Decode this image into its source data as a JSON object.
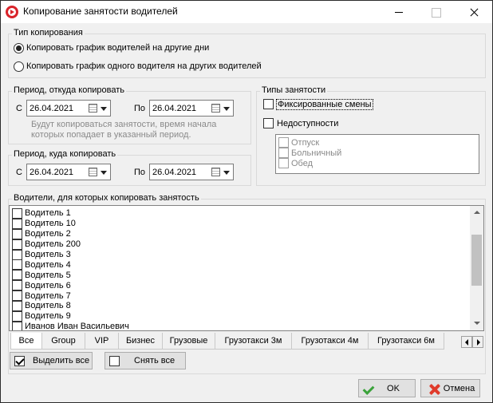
{
  "window": {
    "title": "Копирование занятости водителей",
    "accent_color": "#d9232a"
  },
  "copy_type": {
    "title": "Тип копирования",
    "options": [
      {
        "label": "Копировать график водителей на другие дни",
        "selected": true
      },
      {
        "label": "Копировать график одного водителя на других водителей",
        "selected": false
      }
    ]
  },
  "period_from": {
    "title": "Период, откуда копировать",
    "from_label": "С",
    "from_value": "26.04.2021",
    "to_label": "По",
    "to_value": "26.04.2021",
    "hint_line1": "Будут копироваться занятости, время начала",
    "hint_line2": "которых попадает в указанный период."
  },
  "period_to": {
    "title": "Период, куда копировать",
    "from_label": "С",
    "from_value": "26.04.2021",
    "to_label": "По",
    "to_value": "26.04.2021"
  },
  "occupancy_types": {
    "title": "Типы занятости",
    "fixed_shifts": {
      "label": "Фиксированные смены",
      "checked": false
    },
    "unavailability": {
      "label": "Недоступности",
      "checked": false
    },
    "sub_items": [
      {
        "label": "Отпуск",
        "checked": false
      },
      {
        "label": "Больничный",
        "checked": false
      },
      {
        "label": "Обед",
        "checked": false
      }
    ]
  },
  "drivers": {
    "title": "Водители, для которых копировать занятость",
    "items": [
      {
        "label": "Водитель 1",
        "checked": false
      },
      {
        "label": "Водитель 10",
        "checked": false
      },
      {
        "label": "Водитель 2",
        "checked": false
      },
      {
        "label": "Водитель 200",
        "checked": false
      },
      {
        "label": "Водитель 3",
        "checked": false
      },
      {
        "label": "Водитель 4",
        "checked": false
      },
      {
        "label": "Водитель 5",
        "checked": false
      },
      {
        "label": "Водитель 6",
        "checked": false
      },
      {
        "label": "Водитель 7",
        "checked": false
      },
      {
        "label": "Водитель 8",
        "checked": false
      },
      {
        "label": "Водитель 9",
        "checked": false
      },
      {
        "label": "Иванов Иван Васильевич",
        "checked": false
      }
    ]
  },
  "tabs": [
    {
      "label": "Все",
      "active": true
    },
    {
      "label": "Group",
      "active": false
    },
    {
      "label": "VIP",
      "active": false
    },
    {
      "label": "Бизнес",
      "active": false
    },
    {
      "label": "Грузовые",
      "active": false
    },
    {
      "label": "Грузотакси 3м",
      "active": false
    },
    {
      "label": "Грузотакси 4м",
      "active": false
    },
    {
      "label": "Грузотакси 6м",
      "active": false
    }
  ],
  "actions": {
    "select_all": "Выделить все",
    "deselect_all": "Снять все",
    "ok": "OK",
    "cancel": "Отмена"
  },
  "colors": {
    "ok_icon": "#3aa23a",
    "cancel_icon": "#e03b2b"
  }
}
